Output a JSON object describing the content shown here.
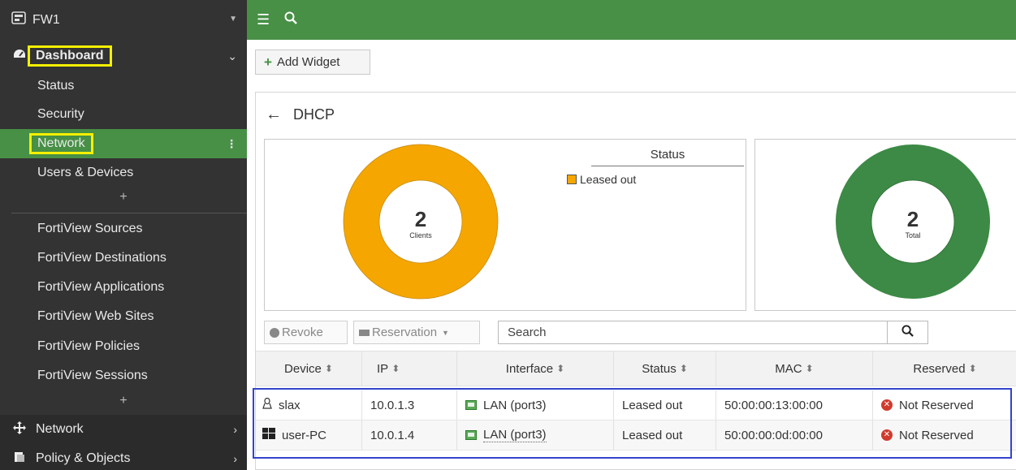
{
  "app": {
    "device_name": "FW1"
  },
  "sidebar": {
    "dashboard_label": "Dashboard",
    "dashboard_items": [
      "Status",
      "Security",
      "Network",
      "Users & Devices"
    ],
    "fortiview_items": [
      "FortiView Sources",
      "FortiView Destinations",
      "FortiView Applications",
      "FortiView Web Sites",
      "FortiView Policies",
      "FortiView Sessions"
    ],
    "network_label": "Network",
    "policy_label": "Policy & Objects",
    "add_symbol": "+"
  },
  "toolbar": {
    "add_widget_label": "Add Widget"
  },
  "widget": {
    "title": "DHCP",
    "clients_chart": {
      "value": "2",
      "sublabel": "Clients",
      "color": "#f5a600"
    },
    "legend": {
      "title": "Status",
      "items": [
        "Leased out"
      ]
    },
    "total_chart": {
      "value": "2",
      "sublabel": "Total",
      "color": "#3c8a45"
    },
    "revoke_label": "Revoke",
    "reservation_label": "Reservation",
    "search_placeholder": "Search"
  },
  "table": {
    "headers": [
      "Device",
      "IP",
      "Interface",
      "Status",
      "MAC",
      "Reserved"
    ],
    "rows": [
      {
        "device": "slax",
        "device_icon": "linux-icon",
        "ip": "10.0.1.3",
        "interface": "LAN (port3)",
        "status": "Leased out",
        "mac": "50:00:00:13:00:00",
        "reserved": "Not Reserved"
      },
      {
        "device": "user-PC",
        "device_icon": "windows-icon",
        "ip": "10.0.1.4",
        "interface": "LAN (port3)",
        "status": "Leased out",
        "mac": "50:00:00:0d:00:00",
        "reserved": "Not Reserved"
      }
    ]
  },
  "colors": {
    "sidebar_bg": "#333333",
    "accent_green": "#479046",
    "highlight_yellow": "#f7f000",
    "annotation_blue": "#3444cc"
  }
}
